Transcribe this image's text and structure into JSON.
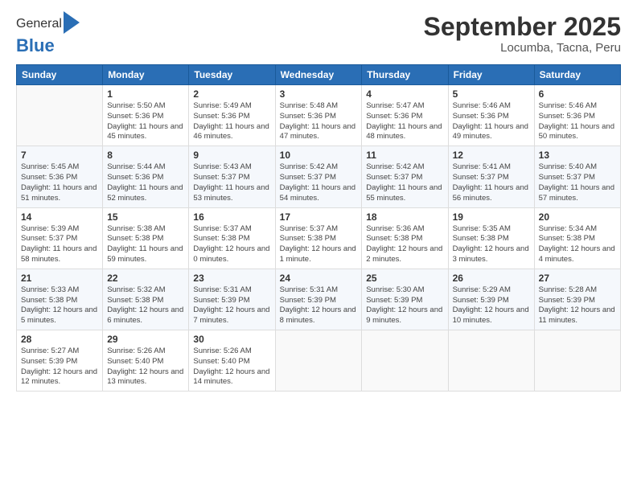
{
  "header": {
    "logo_general": "General",
    "logo_blue": "Blue",
    "main_title": "September 2025",
    "subtitle": "Locumba, Tacna, Peru"
  },
  "days_of_week": [
    "Sunday",
    "Monday",
    "Tuesday",
    "Wednesday",
    "Thursday",
    "Friday",
    "Saturday"
  ],
  "weeks": [
    [
      {
        "num": "",
        "sunrise": "",
        "sunset": "",
        "daylight": ""
      },
      {
        "num": "1",
        "sunrise": "Sunrise: 5:50 AM",
        "sunset": "Sunset: 5:36 PM",
        "daylight": "Daylight: 11 hours and 45 minutes."
      },
      {
        "num": "2",
        "sunrise": "Sunrise: 5:49 AM",
        "sunset": "Sunset: 5:36 PM",
        "daylight": "Daylight: 11 hours and 46 minutes."
      },
      {
        "num": "3",
        "sunrise": "Sunrise: 5:48 AM",
        "sunset": "Sunset: 5:36 PM",
        "daylight": "Daylight: 11 hours and 47 minutes."
      },
      {
        "num": "4",
        "sunrise": "Sunrise: 5:47 AM",
        "sunset": "Sunset: 5:36 PM",
        "daylight": "Daylight: 11 hours and 48 minutes."
      },
      {
        "num": "5",
        "sunrise": "Sunrise: 5:46 AM",
        "sunset": "Sunset: 5:36 PM",
        "daylight": "Daylight: 11 hours and 49 minutes."
      },
      {
        "num": "6",
        "sunrise": "Sunrise: 5:46 AM",
        "sunset": "Sunset: 5:36 PM",
        "daylight": "Daylight: 11 hours and 50 minutes."
      }
    ],
    [
      {
        "num": "7",
        "sunrise": "Sunrise: 5:45 AM",
        "sunset": "Sunset: 5:36 PM",
        "daylight": "Daylight: 11 hours and 51 minutes."
      },
      {
        "num": "8",
        "sunrise": "Sunrise: 5:44 AM",
        "sunset": "Sunset: 5:36 PM",
        "daylight": "Daylight: 11 hours and 52 minutes."
      },
      {
        "num": "9",
        "sunrise": "Sunrise: 5:43 AM",
        "sunset": "Sunset: 5:37 PM",
        "daylight": "Daylight: 11 hours and 53 minutes."
      },
      {
        "num": "10",
        "sunrise": "Sunrise: 5:42 AM",
        "sunset": "Sunset: 5:37 PM",
        "daylight": "Daylight: 11 hours and 54 minutes."
      },
      {
        "num": "11",
        "sunrise": "Sunrise: 5:42 AM",
        "sunset": "Sunset: 5:37 PM",
        "daylight": "Daylight: 11 hours and 55 minutes."
      },
      {
        "num": "12",
        "sunrise": "Sunrise: 5:41 AM",
        "sunset": "Sunset: 5:37 PM",
        "daylight": "Daylight: 11 hours and 56 minutes."
      },
      {
        "num": "13",
        "sunrise": "Sunrise: 5:40 AM",
        "sunset": "Sunset: 5:37 PM",
        "daylight": "Daylight: 11 hours and 57 minutes."
      }
    ],
    [
      {
        "num": "14",
        "sunrise": "Sunrise: 5:39 AM",
        "sunset": "Sunset: 5:37 PM",
        "daylight": "Daylight: 11 hours and 58 minutes."
      },
      {
        "num": "15",
        "sunrise": "Sunrise: 5:38 AM",
        "sunset": "Sunset: 5:38 PM",
        "daylight": "Daylight: 11 hours and 59 minutes."
      },
      {
        "num": "16",
        "sunrise": "Sunrise: 5:37 AM",
        "sunset": "Sunset: 5:38 PM",
        "daylight": "Daylight: 12 hours and 0 minutes."
      },
      {
        "num": "17",
        "sunrise": "Sunrise: 5:37 AM",
        "sunset": "Sunset: 5:38 PM",
        "daylight": "Daylight: 12 hours and 1 minute."
      },
      {
        "num": "18",
        "sunrise": "Sunrise: 5:36 AM",
        "sunset": "Sunset: 5:38 PM",
        "daylight": "Daylight: 12 hours and 2 minutes."
      },
      {
        "num": "19",
        "sunrise": "Sunrise: 5:35 AM",
        "sunset": "Sunset: 5:38 PM",
        "daylight": "Daylight: 12 hours and 3 minutes."
      },
      {
        "num": "20",
        "sunrise": "Sunrise: 5:34 AM",
        "sunset": "Sunset: 5:38 PM",
        "daylight": "Daylight: 12 hours and 4 minutes."
      }
    ],
    [
      {
        "num": "21",
        "sunrise": "Sunrise: 5:33 AM",
        "sunset": "Sunset: 5:38 PM",
        "daylight": "Daylight: 12 hours and 5 minutes."
      },
      {
        "num": "22",
        "sunrise": "Sunrise: 5:32 AM",
        "sunset": "Sunset: 5:38 PM",
        "daylight": "Daylight: 12 hours and 6 minutes."
      },
      {
        "num": "23",
        "sunrise": "Sunrise: 5:31 AM",
        "sunset": "Sunset: 5:39 PM",
        "daylight": "Daylight: 12 hours and 7 minutes."
      },
      {
        "num": "24",
        "sunrise": "Sunrise: 5:31 AM",
        "sunset": "Sunset: 5:39 PM",
        "daylight": "Daylight: 12 hours and 8 minutes."
      },
      {
        "num": "25",
        "sunrise": "Sunrise: 5:30 AM",
        "sunset": "Sunset: 5:39 PM",
        "daylight": "Daylight: 12 hours and 9 minutes."
      },
      {
        "num": "26",
        "sunrise": "Sunrise: 5:29 AM",
        "sunset": "Sunset: 5:39 PM",
        "daylight": "Daylight: 12 hours and 10 minutes."
      },
      {
        "num": "27",
        "sunrise": "Sunrise: 5:28 AM",
        "sunset": "Sunset: 5:39 PM",
        "daylight": "Daylight: 12 hours and 11 minutes."
      }
    ],
    [
      {
        "num": "28",
        "sunrise": "Sunrise: 5:27 AM",
        "sunset": "Sunset: 5:39 PM",
        "daylight": "Daylight: 12 hours and 12 minutes."
      },
      {
        "num": "29",
        "sunrise": "Sunrise: 5:26 AM",
        "sunset": "Sunset: 5:40 PM",
        "daylight": "Daylight: 12 hours and 13 minutes."
      },
      {
        "num": "30",
        "sunrise": "Sunrise: 5:26 AM",
        "sunset": "Sunset: 5:40 PM",
        "daylight": "Daylight: 12 hours and 14 minutes."
      },
      {
        "num": "",
        "sunrise": "",
        "sunset": "",
        "daylight": ""
      },
      {
        "num": "",
        "sunrise": "",
        "sunset": "",
        "daylight": ""
      },
      {
        "num": "",
        "sunrise": "",
        "sunset": "",
        "daylight": ""
      },
      {
        "num": "",
        "sunrise": "",
        "sunset": "",
        "daylight": ""
      }
    ]
  ]
}
